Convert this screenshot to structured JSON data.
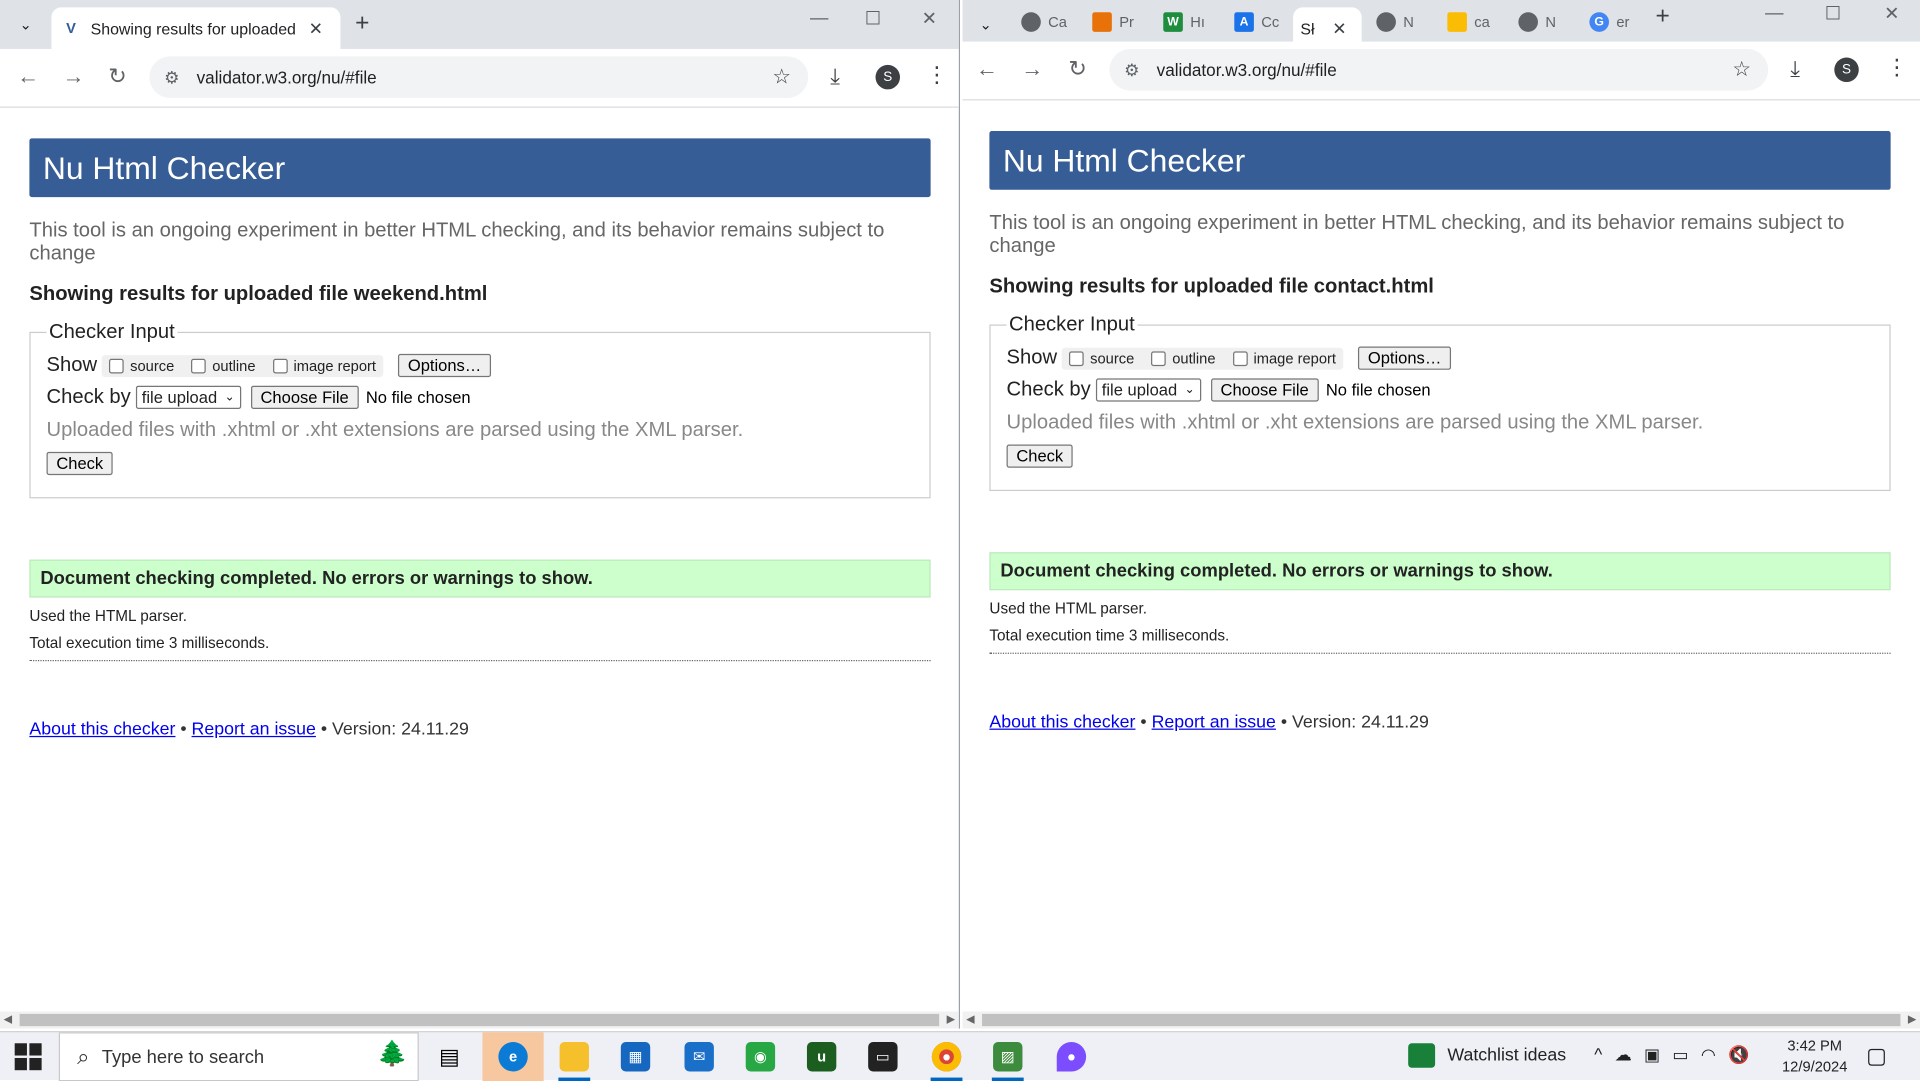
{
  "left_window": {
    "tab_title": "Showing results for uploaded fi",
    "url": "validator.w3.org/nu/#file",
    "profile_initial": "S",
    "page": {
      "header": "Nu Html Checker",
      "description": "This tool is an ongoing experiment in better HTML checking, and its behavior remains subject to change",
      "showing": "Showing results for uploaded file weekend.html",
      "legend": "Checker Input",
      "show_label": "Show",
      "opt_source": "source",
      "opt_outline": "outline",
      "opt_image_report": "image report",
      "options_button": "Options…",
      "check_by_label": "Check by",
      "check_by_value": "file upload",
      "choose_file": "Choose File",
      "no_file": "No file chosen",
      "note": "Uploaded files with .xhtml or .xht extensions are parsed using the XML parser.",
      "check_button": "Check",
      "success": "Document checking completed. No errors or warnings to show.",
      "parser": "Used the HTML parser.",
      "exec_time": "Total execution time 3 milliseconds.",
      "about_link": "About this checker",
      "bullet": "•",
      "report_link": "Report an issue",
      "version": "Version: 24.11.29"
    }
  },
  "right_window": {
    "tabs": [
      {
        "label": "Ca",
        "icon": "chrome-web-icon",
        "color": "#5f6368"
      },
      {
        "label": "Pr",
        "icon": "stack-icon",
        "color": "#e8710a"
      },
      {
        "label": "Hı",
        "icon": "w3-icon",
        "color": "#1e8e3e"
      },
      {
        "label": "Cc",
        "icon": "canvas-icon",
        "color": "#1a73e8"
      }
    ],
    "active_tab_title": "Sł",
    "tabs_after": [
      {
        "label": "N",
        "icon": "chrome-web-icon",
        "color": "#5f6368"
      },
      {
        "label": "ca",
        "icon": "drive-icon",
        "color": "#fbbc04"
      },
      {
        "label": "N",
        "icon": "chrome-web-icon",
        "color": "#5f6368"
      },
      {
        "label": "er",
        "icon": "google-icon",
        "color": "#4285f4"
      }
    ],
    "url": "validator.w3.org/nu/#file",
    "profile_initial": "S",
    "page": {
      "header": "Nu Html Checker",
      "description": "This tool is an ongoing experiment in better HTML checking, and its behavior remains subject to change",
      "showing": "Showing results for uploaded file contact.html",
      "legend": "Checker Input",
      "show_label": "Show",
      "opt_source": "source",
      "opt_outline": "outline",
      "opt_image_report": "image report",
      "options_button": "Options…",
      "check_by_label": "Check by",
      "check_by_value": "file upload",
      "choose_file": "Choose File",
      "no_file": "No file chosen",
      "note": "Uploaded files with .xhtml or .xht extensions are parsed using the XML parser.",
      "check_button": "Check",
      "success": "Document checking completed. No errors or warnings to show.",
      "parser": "Used the HTML parser.",
      "exec_time": "Total execution time 3 milliseconds.",
      "about_link": "About this checker",
      "bullet": "•",
      "report_link": "Report an issue",
      "version": "Version: 24.11.29"
    }
  },
  "taskbar": {
    "search_placeholder": "Type here to search",
    "apps": [
      "task-view-icon",
      "edge-icon",
      "file-explorer-icon",
      "store-icon",
      "mail-icon",
      "game-icon",
      "udemy-icon",
      "terminal-icon",
      "chrome-icon",
      "image-app-icon",
      "paint-drop-icon"
    ],
    "watchlist": "Watchlist ideas",
    "time": "3:42 PM",
    "date": "12/9/2024"
  },
  "colors": {
    "header_bg": "#365d95",
    "success_bg": "#ccffcc",
    "link": "#0000ee",
    "tabbar_bg": "#dfe3e8"
  }
}
